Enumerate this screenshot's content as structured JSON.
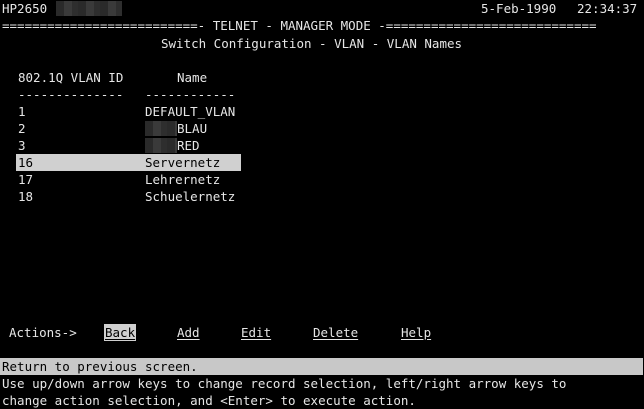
{
  "header": {
    "hostname": "HP2650",
    "date": "5-Feb-1990",
    "time": "22:34:37",
    "banner": "==========================- TELNET - MANAGER MODE -============================",
    "title": "Switch Configuration - VLAN - VLAN Names"
  },
  "table": {
    "columns": [
      "802.1Q VLAN ID",
      "Name"
    ],
    "separators": [
      "--------------",
      "------------"
    ],
    "rows": [
      {
        "id": "1",
        "name": "DEFAULT_VLAN",
        "selected": false
      },
      {
        "id": "2",
        "name": "BLAU",
        "selected": false
      },
      {
        "id": "3",
        "name": "RED",
        "selected": false
      },
      {
        "id": "16",
        "name": "Servernetz",
        "selected": true
      },
      {
        "id": "17",
        "name": "Lehrernetz",
        "selected": false
      },
      {
        "id": "18",
        "name": "Schuelernetz",
        "selected": false
      }
    ]
  },
  "actions": {
    "label": "Actions->",
    "items": [
      "Back",
      "Add",
      "Edit",
      "Delete",
      "Help"
    ],
    "selected": "Back"
  },
  "status": {
    "message": "Return to previous screen.",
    "help_line1": "Use up/down arrow keys to change record selection, left/right arrow keys to",
    "help_line2": "change action selection, and <Enter> to execute action."
  }
}
